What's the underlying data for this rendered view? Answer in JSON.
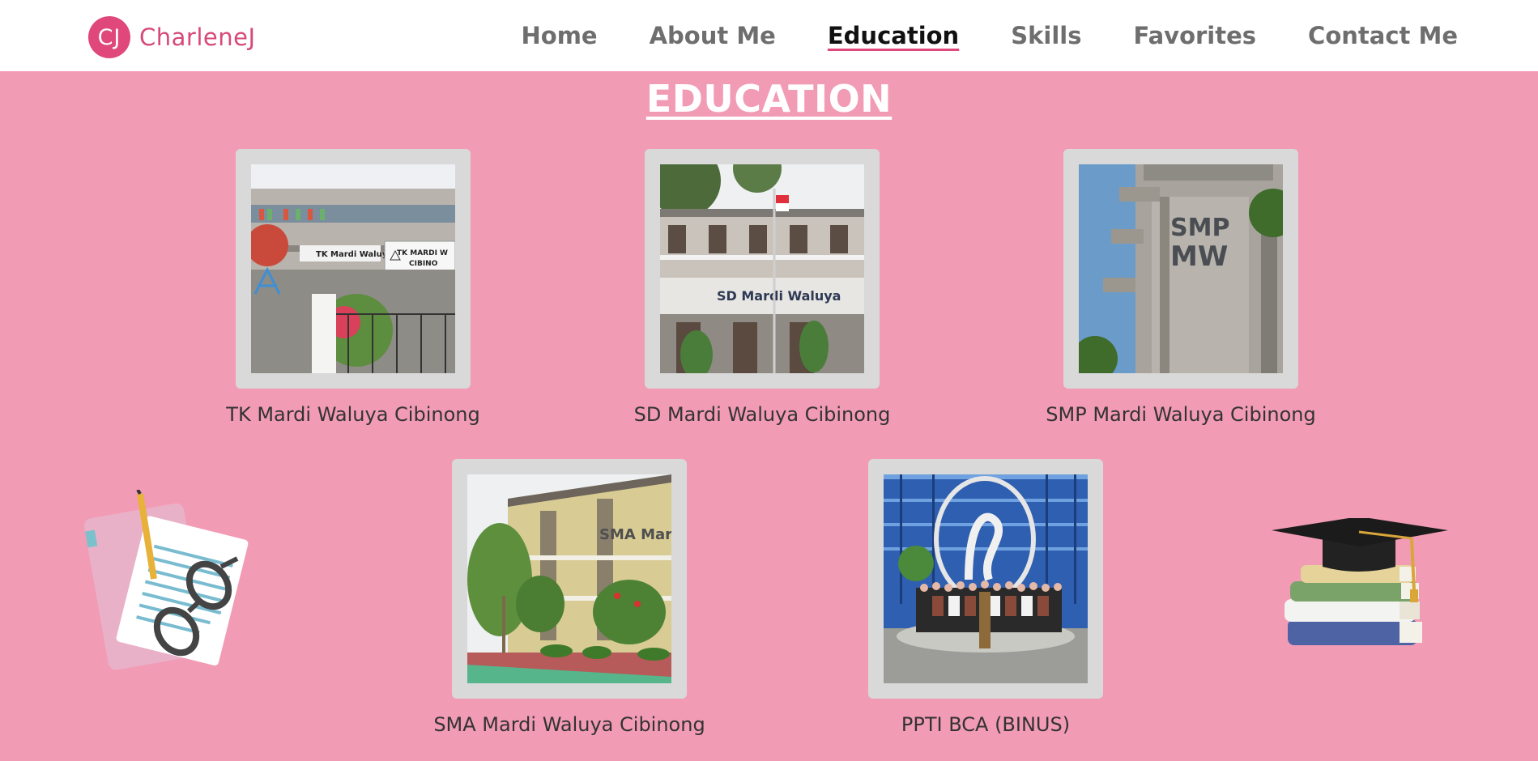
{
  "brand": {
    "badge": "CJ",
    "name": "CharleneJ"
  },
  "nav": [
    {
      "label": "Home",
      "active": false
    },
    {
      "label": "About Me",
      "active": false
    },
    {
      "label": "Education",
      "active": true
    },
    {
      "label": "Skills",
      "active": false
    },
    {
      "label": "Favorites",
      "active": false
    },
    {
      "label": "Contact Me",
      "active": false
    }
  ],
  "section_title": "EDUCATION",
  "schools": [
    {
      "name": "TK Mardi Waluya Cibinong",
      "sign": "TK MARDI WALUYA CIBINONG"
    },
    {
      "name": "SD Mardi Waluya Cibinong",
      "sign": "SD Mardi Waluya"
    },
    {
      "name": "SMP Mardi Waluya Cibinong",
      "sign": "SMP MW"
    },
    {
      "name": "SMA Mardi Waluya Cibinong",
      "sign": "SMA Mard"
    },
    {
      "name": "PPTI BCA (BINUS)",
      "sign": ""
    }
  ],
  "decorations": [
    "notebook-glasses-icon",
    "graduation-cap-books-icon"
  ],
  "colors": {
    "background": "#f29bb5",
    "accent": "#e0477a",
    "frame": "#d9d9d9"
  }
}
